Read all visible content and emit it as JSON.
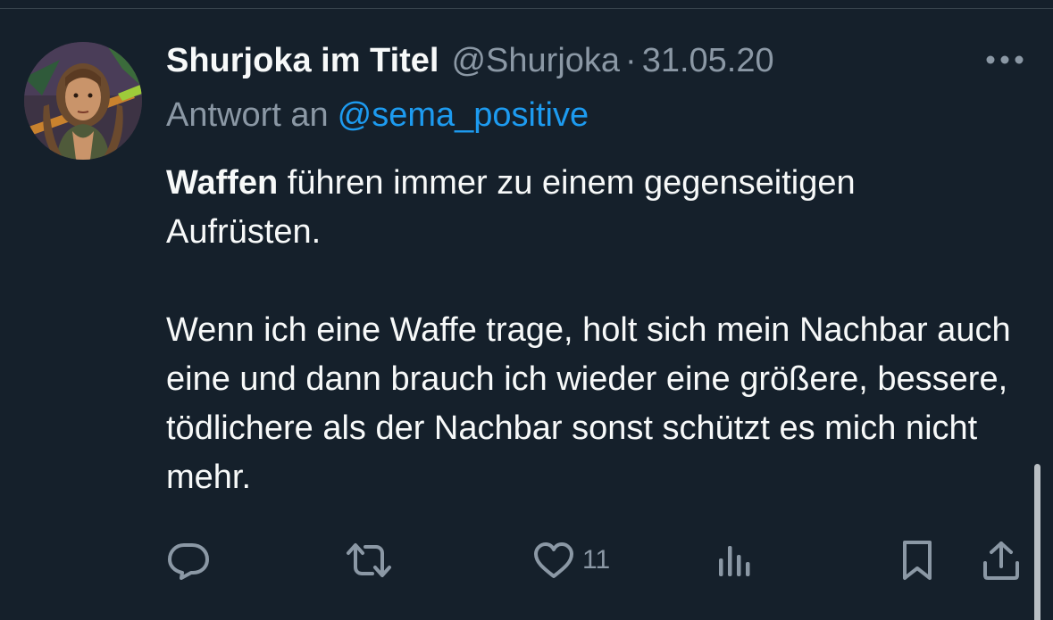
{
  "tweet": {
    "author": {
      "display_name": "Shurjoka im Titel",
      "handle": "@Shurjoka",
      "avatar": "cartoon-character-avatar"
    },
    "separator": "·",
    "date": "31.05.20",
    "reply": {
      "prefix": "Antwort an",
      "mention": "@sema_positive"
    },
    "text": {
      "bold_word": "Waffen",
      "line1_rest": " führen immer zu einem gegenseitigen",
      "line2": "Aufrüsten.",
      "paragraph2": "Wenn ich eine Waffe trage, holt sich mein Nachbar auch eine und dann brauch ich wieder eine größere, bessere, tödlichere als der Nachbar sonst schützt es mich nicht mehr."
    },
    "actions": {
      "reply_icon": "reply-bubble-icon",
      "retweet_icon": "retweet-icon",
      "like_icon": "heart-icon",
      "like_count": "11",
      "views_icon": "bar-chart-icon",
      "bookmark_icon": "bookmark-icon",
      "share_icon": "share-icon"
    }
  },
  "colors": {
    "background": "#15202b",
    "text_primary": "#f7f9f9",
    "text_secondary": "#8b98a5",
    "link": "#1d9bf0"
  }
}
